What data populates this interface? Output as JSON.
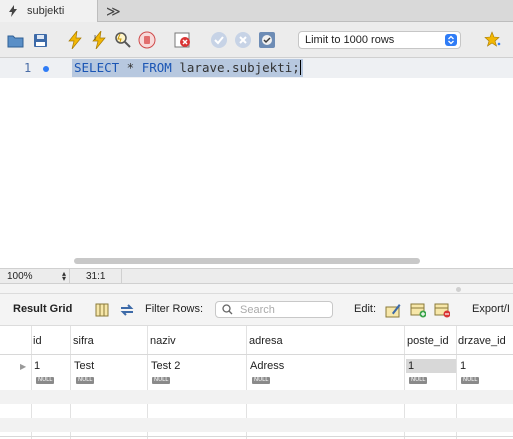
{
  "tab": {
    "label": "subjekti",
    "overflow": "≫"
  },
  "toolbar": {
    "icons": [
      "folder-icon",
      "save-icon",
      "execute-icon",
      "execute-current-icon",
      "explain-icon",
      "stop-icon",
      "toggle-error-icon",
      "commit-icon",
      "rollback-icon",
      "autocommit-icon",
      "favorite-icon"
    ],
    "limit_label": "Limit to 1000 rows",
    "accent": "#2f7cf6"
  },
  "editor": {
    "line_number": "1",
    "kw_select": "SELECT",
    "star": " * ",
    "kw_from": "FROM",
    "rest": " larave.subjekti;",
    "selection_color": "#b7c8df"
  },
  "status": {
    "zoom": "100%",
    "cursor": "31:1"
  },
  "results": {
    "title": "Result Grid",
    "filter_label": "Filter Rows:",
    "search_placeholder": "Search",
    "edit_label": "Edit:",
    "export_label": "Export/I",
    "columns": [
      "id",
      "sifra",
      "naziv",
      "adresa",
      "poste_id",
      "drzave_id"
    ],
    "row": [
      "1",
      "Test",
      "Test 2",
      "Adress",
      "1",
      "1"
    ],
    "null_badge": "NULL"
  }
}
